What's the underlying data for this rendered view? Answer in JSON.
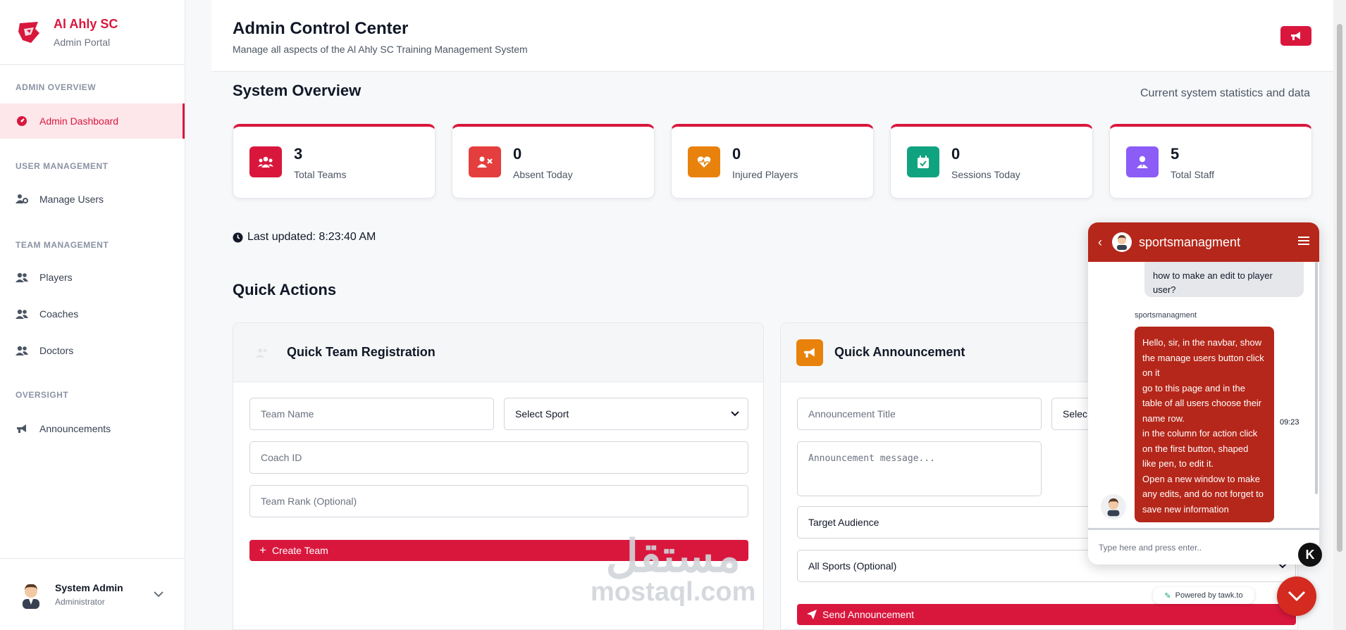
{
  "brand": {
    "title": "Al Ahly SC",
    "subtitle": "Admin Portal"
  },
  "sidebar": {
    "sections": [
      {
        "title": "ADMIN OVERVIEW"
      },
      {
        "title": "USER MANAGEMENT"
      },
      {
        "title": "TEAM MANAGEMENT"
      },
      {
        "title": "OVERSIGHT"
      }
    ],
    "items": [
      {
        "label": "Admin Dashboard",
        "icon": "dashboard-icon",
        "active": true
      },
      {
        "label": "Manage Users",
        "icon": "users-cog-icon"
      },
      {
        "label": "Players",
        "icon": "users-icon"
      },
      {
        "label": "Coaches",
        "icon": "users-icon"
      },
      {
        "label": "Doctors",
        "icon": "users-icon"
      },
      {
        "label": "Announcements",
        "icon": "megaphone-icon"
      }
    ],
    "user": {
      "name": "System Admin",
      "role": "Administrator"
    }
  },
  "header": {
    "title": "Admin Control Center",
    "subtitle": "Manage all aspects of the Al Ahly SC Training Management System"
  },
  "overview": {
    "title": "System Overview",
    "right_text": "Current system statistics and data",
    "stats": [
      {
        "value": "3",
        "label": "Total Teams",
        "color": "#d9173d"
      },
      {
        "value": "0",
        "label": "Absent Today",
        "color": "#e53e3e"
      },
      {
        "value": "0",
        "label": "Injured Players",
        "color": "#e8820c"
      },
      {
        "value": "0",
        "label": "Sessions Today",
        "color": "#10a37f"
      },
      {
        "value": "5",
        "label": "Total Staff",
        "color": "#8b5cf6"
      }
    ],
    "last_updated": "Last updated: 8:23:40 AM"
  },
  "quick_actions": {
    "title": "Quick Actions",
    "team_registration": {
      "title": "Quick Team Registration",
      "team_name_placeholder": "Team Name",
      "sport_select": "Select Sport",
      "coach_placeholder": "Coach ID",
      "rank_placeholder": "Team Rank (Optional)",
      "button": "Create Team"
    },
    "announcement": {
      "title": "Quick Announcement",
      "title_placeholder": "Announcement Title",
      "select_partial": "Selec",
      "message_placeholder": "Announcement message...",
      "audience_select": "Target Audience",
      "sports_select": "All Sports (Optional)",
      "button": "Send Announcement"
    }
  },
  "watermark": {
    "arabic": "مستقل",
    "latin": "mostaql.com"
  },
  "chat": {
    "name": "sportsmanagment",
    "user_message": "how to make an edit to player user?",
    "sender": "sportsmanagment",
    "bot_message_lines": [
      "Hello, sir, in the navbar, show",
      "the manage users button click",
      "on it",
      "go to this page and in the",
      "table of all users choose their",
      "name row.",
      "in the column for action click",
      "on the first button, shaped",
      "like  pen,  to edit it.",
      "Open a new window to make",
      "any edits, and do not forget to",
      "save new information"
    ],
    "time": "09:23",
    "input_placeholder": "Type here and press enter..",
    "powered_by": "Powered by tawk.to"
  }
}
